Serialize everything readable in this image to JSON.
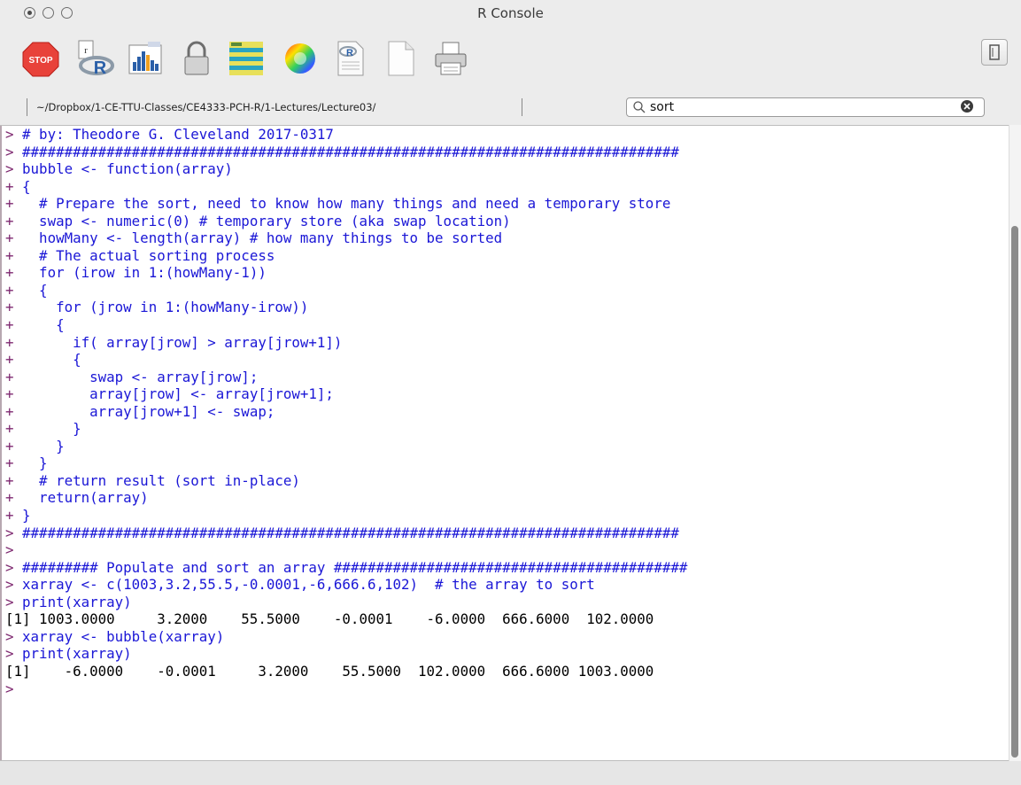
{
  "window": {
    "title": "R Console"
  },
  "toolbar": {
    "buttons": [
      {
        "icon": "stop-icon",
        "label": "STOP"
      },
      {
        "icon": "r-source-icon"
      },
      {
        "icon": "chart-icon"
      },
      {
        "icon": "lock-icon"
      },
      {
        "icon": "data-editor-icon"
      },
      {
        "icon": "color-wheel-icon"
      },
      {
        "icon": "r-script-icon"
      },
      {
        "icon": "new-document-icon"
      },
      {
        "icon": "print-icon"
      }
    ]
  },
  "pathbar": {
    "path": "~/Dropbox/1-CE-TTU-Classes/CE4333-PCH-R/1-Lectures/Lecture03/"
  },
  "search": {
    "value": "sort"
  },
  "console": {
    "lines": [
      {
        "prompt": "> ",
        "text": "# by: Theodore G. Cleveland 2017-0317",
        "kind": "in"
      },
      {
        "prompt": "> ",
        "text": "##############################################################################",
        "kind": "in"
      },
      {
        "prompt": "> ",
        "text": "bubble <- function(array)",
        "kind": "in"
      },
      {
        "prompt": "+ ",
        "text": "{",
        "kind": "in"
      },
      {
        "prompt": "+ ",
        "text": "  # Prepare the sort, need to know how many things and need a temporary store",
        "kind": "in"
      },
      {
        "prompt": "+ ",
        "text": "  swap <- numeric(0) # temporary store (aka swap location)",
        "kind": "in"
      },
      {
        "prompt": "+ ",
        "text": "  howMany <- length(array) # how many things to be sorted",
        "kind": "in"
      },
      {
        "prompt": "+ ",
        "text": "  # The actual sorting process",
        "kind": "in"
      },
      {
        "prompt": "+ ",
        "text": "  for (irow in 1:(howMany-1))",
        "kind": "in"
      },
      {
        "prompt": "+ ",
        "text": "  {",
        "kind": "in"
      },
      {
        "prompt": "+ ",
        "text": "    for (jrow in 1:(howMany-irow))",
        "kind": "in"
      },
      {
        "prompt": "+ ",
        "text": "    {",
        "kind": "in"
      },
      {
        "prompt": "+ ",
        "text": "      if( array[jrow] > array[jrow+1])",
        "kind": "in"
      },
      {
        "prompt": "+ ",
        "text": "      {",
        "kind": "in"
      },
      {
        "prompt": "+ ",
        "text": "        swap <- array[jrow];",
        "kind": "in"
      },
      {
        "prompt": "+ ",
        "text": "        array[jrow] <- array[jrow+1];",
        "kind": "in"
      },
      {
        "prompt": "+ ",
        "text": "        array[jrow+1] <- swap;",
        "kind": "in"
      },
      {
        "prompt": "+ ",
        "text": "      }",
        "kind": "in"
      },
      {
        "prompt": "+ ",
        "text": "    }",
        "kind": "in"
      },
      {
        "prompt": "+ ",
        "text": "  }",
        "kind": "in"
      },
      {
        "prompt": "+ ",
        "text": "  # return result (sort in-place)",
        "kind": "in"
      },
      {
        "prompt": "+ ",
        "text": "  return(array)",
        "kind": "in"
      },
      {
        "prompt": "+ ",
        "text": "}",
        "kind": "in"
      },
      {
        "prompt": "> ",
        "text": "##############################################################################",
        "kind": "in"
      },
      {
        "prompt": ">",
        "text": "",
        "kind": "in"
      },
      {
        "prompt": "> ",
        "text": "######### Populate and sort an array ##########################################",
        "kind": "in"
      },
      {
        "prompt": "> ",
        "text": "xarray <- c(1003,3.2,55.5,-0.0001,-6,666.6,102)  # the array to sort",
        "kind": "in"
      },
      {
        "prompt": "> ",
        "text": "print(xarray)",
        "kind": "in"
      },
      {
        "prompt": "",
        "text": "[1] 1003.0000     3.2000    55.5000    -0.0001    -6.0000  666.6000  102.0000",
        "kind": "out"
      },
      {
        "prompt": "> ",
        "text": "xarray <- bubble(xarray)",
        "kind": "in"
      },
      {
        "prompt": "> ",
        "text": "print(xarray)",
        "kind": "in"
      },
      {
        "prompt": "",
        "text": "[1]    -6.0000    -0.0001     3.2000    55.5000  102.0000  666.6000 1003.0000",
        "kind": "out"
      },
      {
        "prompt": ">",
        "text": "",
        "kind": "in"
      }
    ]
  }
}
